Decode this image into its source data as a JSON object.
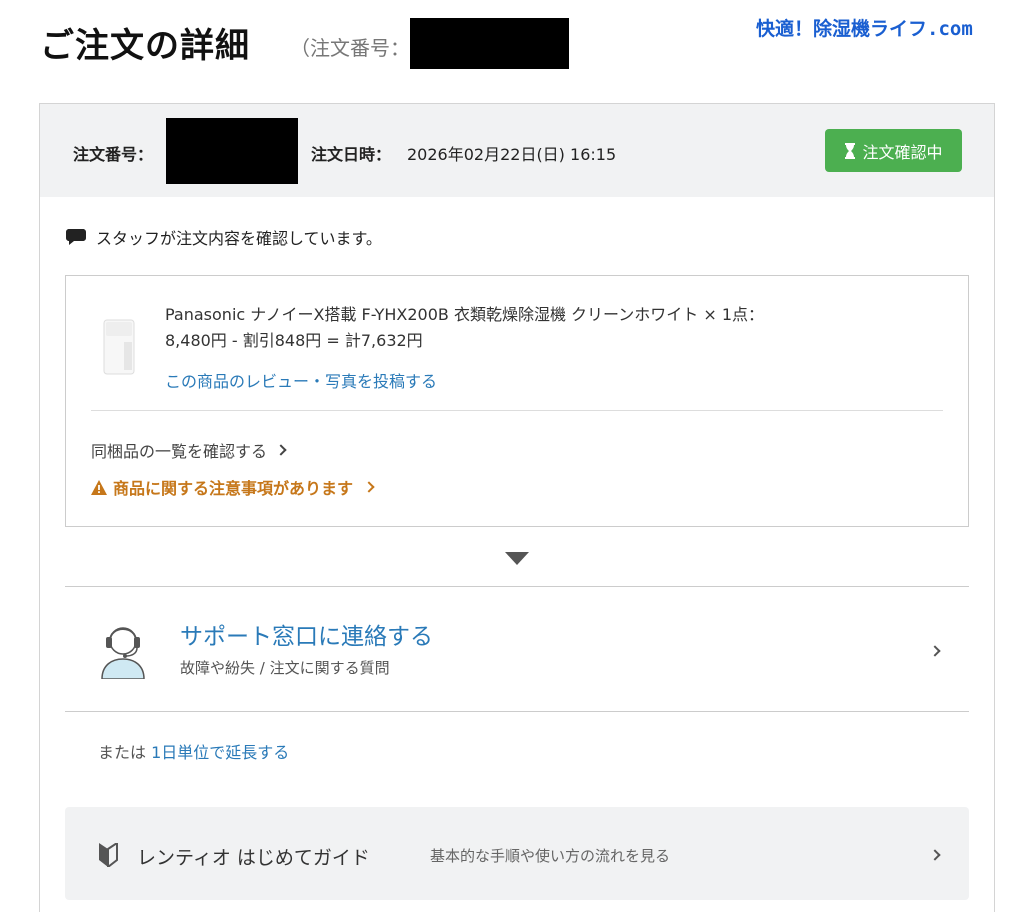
{
  "page": {
    "title": "ご注文の詳細",
    "title_order_label": "（注文番号：",
    "site_logo": "快適！除湿機ライフ.com"
  },
  "order": {
    "number_label": "注文番号：",
    "date_label": "注文日時：",
    "date_value": "2026年02月22日(日) 16:15",
    "status": "注文確認中"
  },
  "message": "スタッフが注文内容を確認しています。",
  "item": {
    "name_line": "Panasonic ナノイーX搭載 F-YHX200B 衣類乾燥除湿機 クリーンホワイト × 1点：",
    "price_line": "8,480円 - 割引848円 = 計7,632円",
    "review_link": "この商品のレビュー・写真を投稿する",
    "bundle_link": "同梱品の一覧を確認する",
    "warning_link": "商品に関する注意事項があります"
  },
  "support": {
    "title": "サポート窓口に連絡する",
    "subtitle": "故障や紛失 / 注文に関する質問"
  },
  "extend": {
    "prefix": "または",
    "link": "1日単位で延長する"
  },
  "guide": {
    "title": "レンティオ はじめてガイド",
    "subtitle": "基本的な手順や使い方の流れを見る"
  },
  "colors": {
    "status_green": "#4caf50",
    "link_blue": "#2a7ab8",
    "warning_orange": "#c6771a",
    "logo_blue": "#1a5fd1"
  },
  "icons": [
    "hourglass-icon",
    "chat-icon",
    "warning-icon",
    "support-agent-icon",
    "beginner-mark-icon",
    "chevron-right-icon",
    "caret-down-icon"
  ]
}
